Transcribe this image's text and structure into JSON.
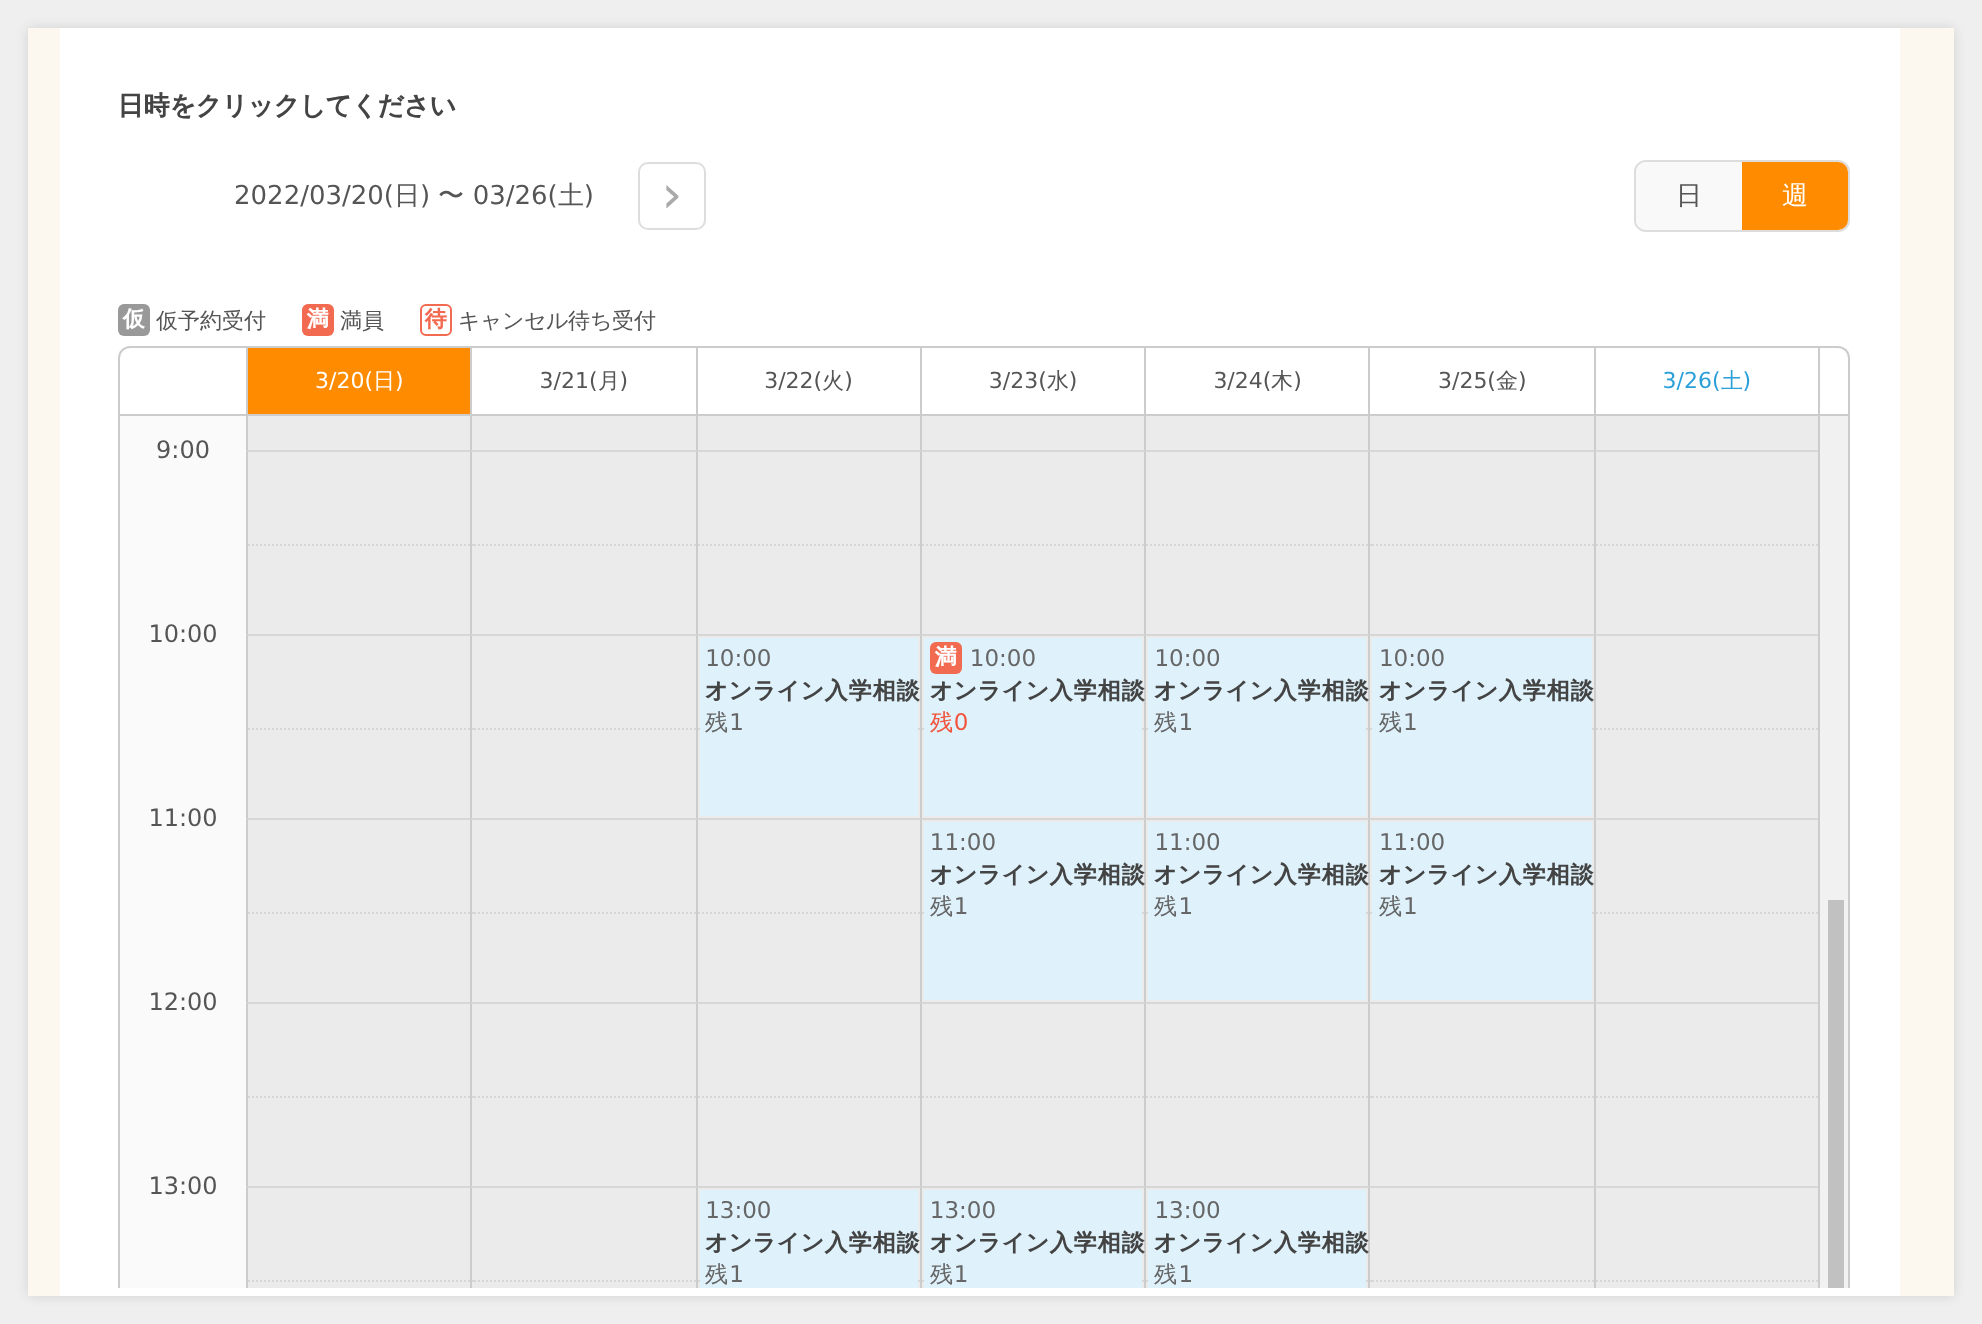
{
  "heading": "日時をクリックしてください",
  "range": {
    "text": "2022/03/20(日) 〜 03/26(土)",
    "next": "›"
  },
  "view_toggle": [
    {
      "label": "日",
      "selected": false
    },
    {
      "label": "週",
      "selected": true
    }
  ],
  "legend": [
    {
      "kind": "tentative",
      "badge": "仮",
      "label": "仮予約受付"
    },
    {
      "kind": "full",
      "badge": "満",
      "label": "満員"
    },
    {
      "kind": "waitlist",
      "badge": "待",
      "label": "キャンセル待ち受付"
    }
  ],
  "days": [
    {
      "label": "3/20(日)",
      "selected": true,
      "kind": "weekday"
    },
    {
      "label": "3/21(月)",
      "selected": false,
      "kind": "weekday"
    },
    {
      "label": "3/22(火)",
      "selected": false,
      "kind": "weekday"
    },
    {
      "label": "3/23(水)",
      "selected": false,
      "kind": "weekday"
    },
    {
      "label": "3/24(木)",
      "selected": false,
      "kind": "weekday"
    },
    {
      "label": "3/25(金)",
      "selected": false,
      "kind": "weekday"
    },
    {
      "label": "3/26(土)",
      "selected": false,
      "kind": "saturday"
    }
  ],
  "rows": [
    {
      "time": "9:00",
      "cells": [
        {
          "kind": "empty"
        },
        {
          "kind": "empty"
        },
        {
          "kind": "empty"
        },
        {
          "kind": "empty"
        },
        {
          "kind": "empty"
        },
        {
          "kind": "empty"
        },
        {
          "kind": "empty"
        }
      ]
    },
    {
      "time": "10:00",
      "cells": [
        {
          "kind": "empty"
        },
        {
          "kind": "empty"
        },
        {
          "kind": "event",
          "time": "10:00",
          "title": "オンライン入学相談",
          "remaining": "残1",
          "full": false
        },
        {
          "kind": "event",
          "time": "10:00",
          "title": "オンライン入学相談",
          "remaining": "残0",
          "full": true,
          "badge": "満"
        },
        {
          "kind": "event",
          "time": "10:00",
          "title": "オンライン入学相談",
          "remaining": "残1",
          "full": false
        },
        {
          "kind": "event",
          "time": "10:00",
          "title": "オンライン入学相談",
          "remaining": "残1",
          "full": false
        },
        {
          "kind": "empty"
        }
      ]
    },
    {
      "time": "11:00",
      "cells": [
        {
          "kind": "empty"
        },
        {
          "kind": "empty"
        },
        {
          "kind": "empty"
        },
        {
          "kind": "event",
          "time": "11:00",
          "title": "オンライン入学相談",
          "remaining": "残1",
          "full": false
        },
        {
          "kind": "event",
          "time": "11:00",
          "title": "オンライン入学相談",
          "remaining": "残1",
          "full": false
        },
        {
          "kind": "event",
          "time": "11:00",
          "title": "オンライン入学相談",
          "remaining": "残1",
          "full": false
        },
        {
          "kind": "empty"
        }
      ]
    },
    {
      "time": "12:00",
      "cells": [
        {
          "kind": "empty"
        },
        {
          "kind": "empty"
        },
        {
          "kind": "empty"
        },
        {
          "kind": "empty"
        },
        {
          "kind": "empty"
        },
        {
          "kind": "empty"
        },
        {
          "kind": "empty"
        }
      ]
    },
    {
      "time": "13:00",
      "cells": [
        {
          "kind": "empty"
        },
        {
          "kind": "empty"
        },
        {
          "kind": "event",
          "time": "13:00",
          "title": "オンライン入学相談",
          "remaining": "残1",
          "full": false
        },
        {
          "kind": "event",
          "time": "13:00",
          "title": "オンライン入学相談",
          "remaining": "残1",
          "full": false
        },
        {
          "kind": "event",
          "time": "13:00",
          "title": "オンライン入学相談",
          "remaining": "残1",
          "full": false
        },
        {
          "kind": "empty"
        },
        {
          "kind": "empty"
        }
      ]
    }
  ]
}
